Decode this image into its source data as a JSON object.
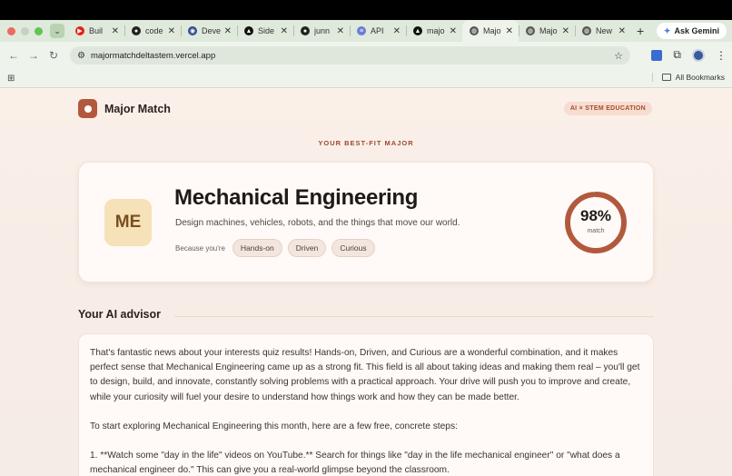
{
  "browser": {
    "tabs": [
      {
        "label": "Buil",
        "fav_color": "#e62117",
        "fav_glyph": "▶"
      },
      {
        "label": "code",
        "fav_color": "#222222",
        "fav_glyph": "●"
      },
      {
        "label": "Deve",
        "fav_color": "#2f4a8a",
        "fav_glyph": "◉"
      },
      {
        "label": "Side",
        "fav_color": "#111111",
        "fav_glyph": "▲"
      },
      {
        "label": "junn",
        "fav_color": "#222222",
        "fav_glyph": "●"
      },
      {
        "label": "API",
        "fav_color": "#6e7bd6",
        "fav_glyph": "≡"
      },
      {
        "label": "majo",
        "fav_color": "#111111",
        "fav_glyph": "▲"
      },
      {
        "label": "Majo",
        "fav_color": "#555555",
        "fav_glyph": "◍",
        "active": true
      },
      {
        "label": "Majo",
        "fav_color": "#555555",
        "fav_glyph": "◍"
      },
      {
        "label": "New",
        "fav_color": "#555555",
        "fav_glyph": "◍"
      }
    ],
    "gemini_label": "Ask Gemini",
    "url": "majormatchdeltastem.vercel.app",
    "all_bookmarks": "All Bookmarks"
  },
  "header": {
    "brand": "Major Match",
    "tag": "AI × STEM EDUCATION"
  },
  "result": {
    "kicker": "YOUR BEST-FIT MAJOR",
    "initials": "ME",
    "title": "Mechanical Engineering",
    "description": "Design machines, vehicles, robots, and the things that move our world.",
    "because_label": "Because you're",
    "traits": [
      "Hands-on",
      "Driven",
      "Curious"
    ],
    "match_percent": 98,
    "match_value": "98%",
    "match_label": "match",
    "accent": "#b2593d"
  },
  "advisor": {
    "heading": "Your AI advisor",
    "paragraphs": [
      "That's fantastic news about your interests quiz results! Hands-on, Driven, and Curious are a wonderful combination, and it makes perfect sense that Mechanical Engineering came up as a strong fit. This field is all about taking ideas and making them real – you'll get to design, build, and innovate, constantly solving problems with a practical approach. Your drive will push you to improve and create, while your curiosity will fuel your desire to understand how things work and how they can be made better.",
      "To start exploring Mechanical Engineering this month, here are a few free, concrete steps:",
      "1. **Watch some \"day in the life\" videos on YouTube.** Search for things like \"day in the life mechanical engineer\" or \"what does a mechanical engineer do.\" This can give you a real-world glimpse beyond the classroom."
    ]
  }
}
